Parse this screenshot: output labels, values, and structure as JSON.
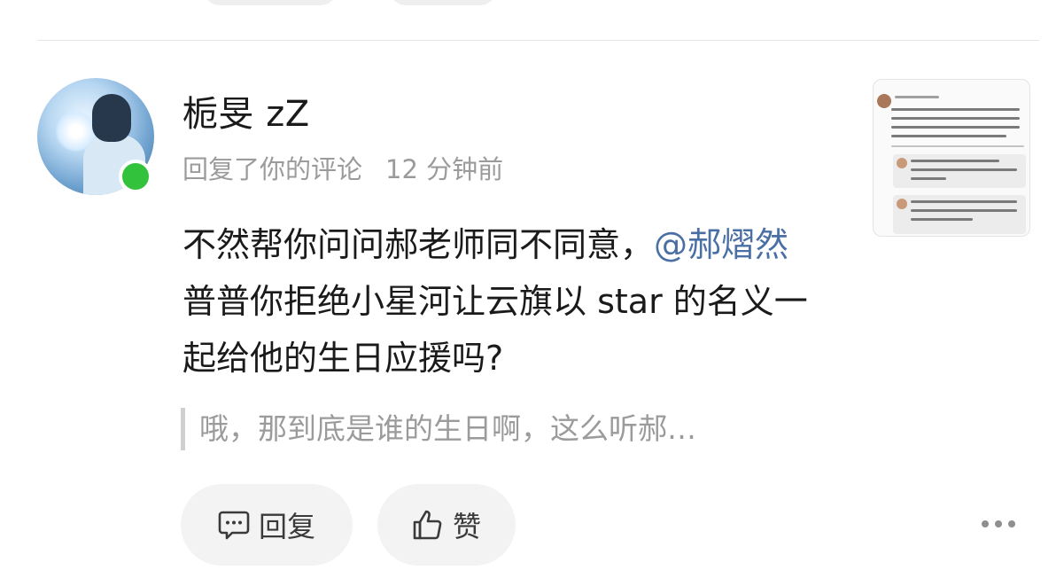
{
  "comment": {
    "username": "栀旻 zZ",
    "action": "回复了你的评论",
    "time": "12 分钟前",
    "text_part1": "不然帮你问问郝老师同不同意，",
    "mention": "@郝熠然",
    "text_part2": " 普普你拒绝小星河让云旗以 star 的名义一起给他的生日应援吗?",
    "quoted_text": "哦，那到底是谁的生日啊，这么听郝…",
    "online": true
  },
  "actions": {
    "reply_label": "回复",
    "like_label": "赞",
    "reply_icon": "comment-bubble-icon",
    "like_icon": "thumbs-up-icon",
    "more_icon": "more-dots-icon"
  },
  "colors": {
    "mention": "#4a6fa5",
    "online": "#33c23b",
    "meta_text": "#9b9b9b",
    "button_bg": "#f3f3f3"
  }
}
